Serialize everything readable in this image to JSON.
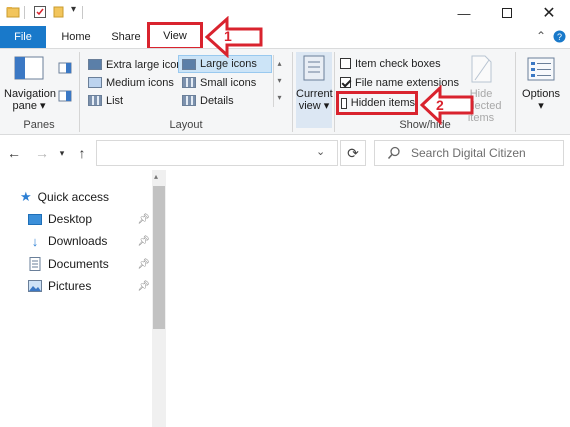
{
  "ribbon_tabs": {
    "file": "File",
    "home": "Home",
    "share": "Share",
    "view": "View"
  },
  "panes": {
    "navigation_pane": [
      "Navigation",
      "pane"
    ],
    "group_label": "Panes"
  },
  "layout": {
    "options": [
      "Extra large icons",
      "Large icons",
      "Medium icons",
      "Small icons",
      "List",
      "Details"
    ],
    "selected": "Large icons",
    "group_label": "Layout"
  },
  "current_view": [
    "Current",
    "view"
  ],
  "show_hide": {
    "item_check_boxes": "Item check boxes",
    "file_name_extensions": "File name extensions",
    "hidden_items": "Hidden items",
    "hide_selected_items": [
      "Hide selected",
      "items"
    ],
    "group_label": "Show/hide",
    "item_check_boxes_checked": false,
    "file_name_extensions_checked": true,
    "hidden_items_checked": false
  },
  "options_label": "Options",
  "search_placeholder": "Search Digital Citizen",
  "nav_pane": {
    "quick_access": "Quick access",
    "items": [
      "Desktop",
      "Downloads",
      "Documents",
      "Pictures"
    ]
  },
  "annotations": {
    "step1": "1",
    "step2": "2"
  },
  "colors": {
    "file_tab": "#1979ca",
    "callout": "#d9232e",
    "ribbon_bg": "#f5f6f7"
  }
}
